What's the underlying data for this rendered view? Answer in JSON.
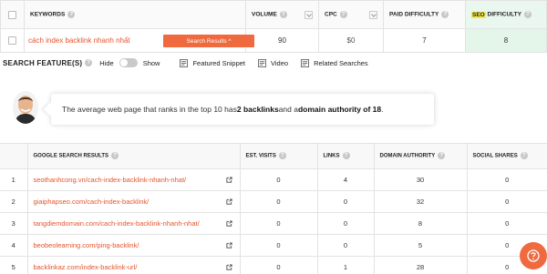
{
  "keywords_table": {
    "headers": {
      "keywords": "KEYWORDS",
      "volume": "VOLUME",
      "cpc": "CPC",
      "paid_difficulty": "PAID DIFFICULTY",
      "seo_difficulty_hl": "SEO",
      "seo_difficulty_rest": " DIFFICULTY"
    },
    "row": {
      "keyword": "cách index backlink nhanh nhất",
      "button_label": "Search Results ^",
      "volume": "90",
      "cpc": "$0",
      "paid_difficulty": "7",
      "seo_difficulty": "8"
    }
  },
  "search_features": {
    "title": "SEARCH FEATURE(S)",
    "hide_label": "Hide",
    "show_label": "Show",
    "items": [
      "Featured Snippet",
      "Video",
      "Related Searches"
    ]
  },
  "insight": {
    "prefix": "The average web page that ranks in the top 10 has ",
    "backlinks": "2 backlinks",
    "middle": " and a ",
    "authority": "domain authority of 18",
    "suffix": "."
  },
  "results_table": {
    "headers": {
      "google_results": "GOOGLE SEARCH RESULTS",
      "est_visits": "EST. VISITS",
      "links": "LINKS",
      "domain_authority": "DOMAIN AUTHORITY",
      "social_shares": "SOCIAL SHARES"
    },
    "rows": [
      {
        "n": "1",
        "url": "seothanhcong.vn/cach-index-backlink-nhanh-nhat/",
        "visits": "0",
        "links": "4",
        "da": "30",
        "shares": "0"
      },
      {
        "n": "2",
        "url": "giaiphapseo.com/cach-index-backlink/",
        "visits": "0",
        "links": "0",
        "da": "32",
        "shares": "0"
      },
      {
        "n": "3",
        "url": "tangdiemdomain.com/cach-index-backlink-nhanh-nhat/",
        "visits": "0",
        "links": "0",
        "da": "8",
        "shares": "0"
      },
      {
        "n": "4",
        "url": "beobeolearning.com/ping-backlink/",
        "visits": "0",
        "links": "0",
        "da": "5",
        "shares": "0"
      },
      {
        "n": "5",
        "url": "backlinkaz.com/index-backlink-url/",
        "visits": "0",
        "links": "1",
        "da": "28",
        "shares": "0"
      }
    ]
  },
  "colors": {
    "accent": "#ef6a3e",
    "link": "#e5542c",
    "seo_highlight": "#f3e84a",
    "seo_bg": "#e4f6ea"
  }
}
